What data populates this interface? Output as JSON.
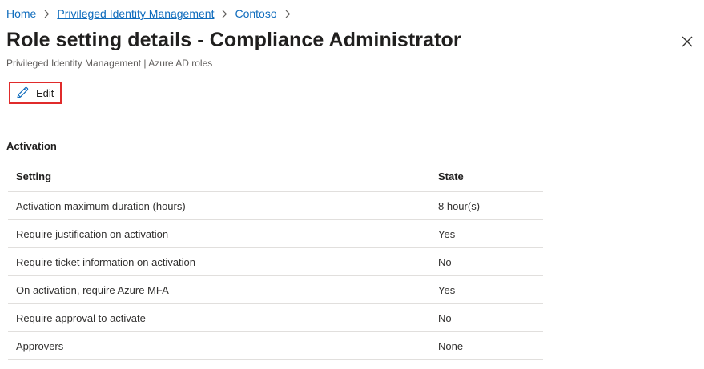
{
  "breadcrumb": {
    "home": "Home",
    "pim": "Privileged Identity Management",
    "tenant": "Contoso"
  },
  "header": {
    "title": "Role setting details - Compliance Administrator",
    "subtitle": "Privileged Identity Management | Azure AD roles"
  },
  "toolbar": {
    "edit_label": "Edit"
  },
  "activation": {
    "section_title": "Activation",
    "columns": {
      "setting": "Setting",
      "state": "State"
    },
    "rows": [
      {
        "setting": "Activation maximum duration (hours)",
        "state": "8 hour(s)"
      },
      {
        "setting": "Require justification on activation",
        "state": "Yes"
      },
      {
        "setting": "Require ticket information on activation",
        "state": "No"
      },
      {
        "setting": "On activation, require Azure MFA",
        "state": "Yes"
      },
      {
        "setting": "Require approval to activate",
        "state": "No"
      },
      {
        "setting": "Approvers",
        "state": "None"
      }
    ]
  },
  "icons": {
    "edit": "pencil-icon",
    "close": "close-icon",
    "separator": "chevron-right-icon"
  },
  "colors": {
    "link": "#0f6cbd",
    "highlight_border": "#e02b2b",
    "text": "#323130"
  }
}
